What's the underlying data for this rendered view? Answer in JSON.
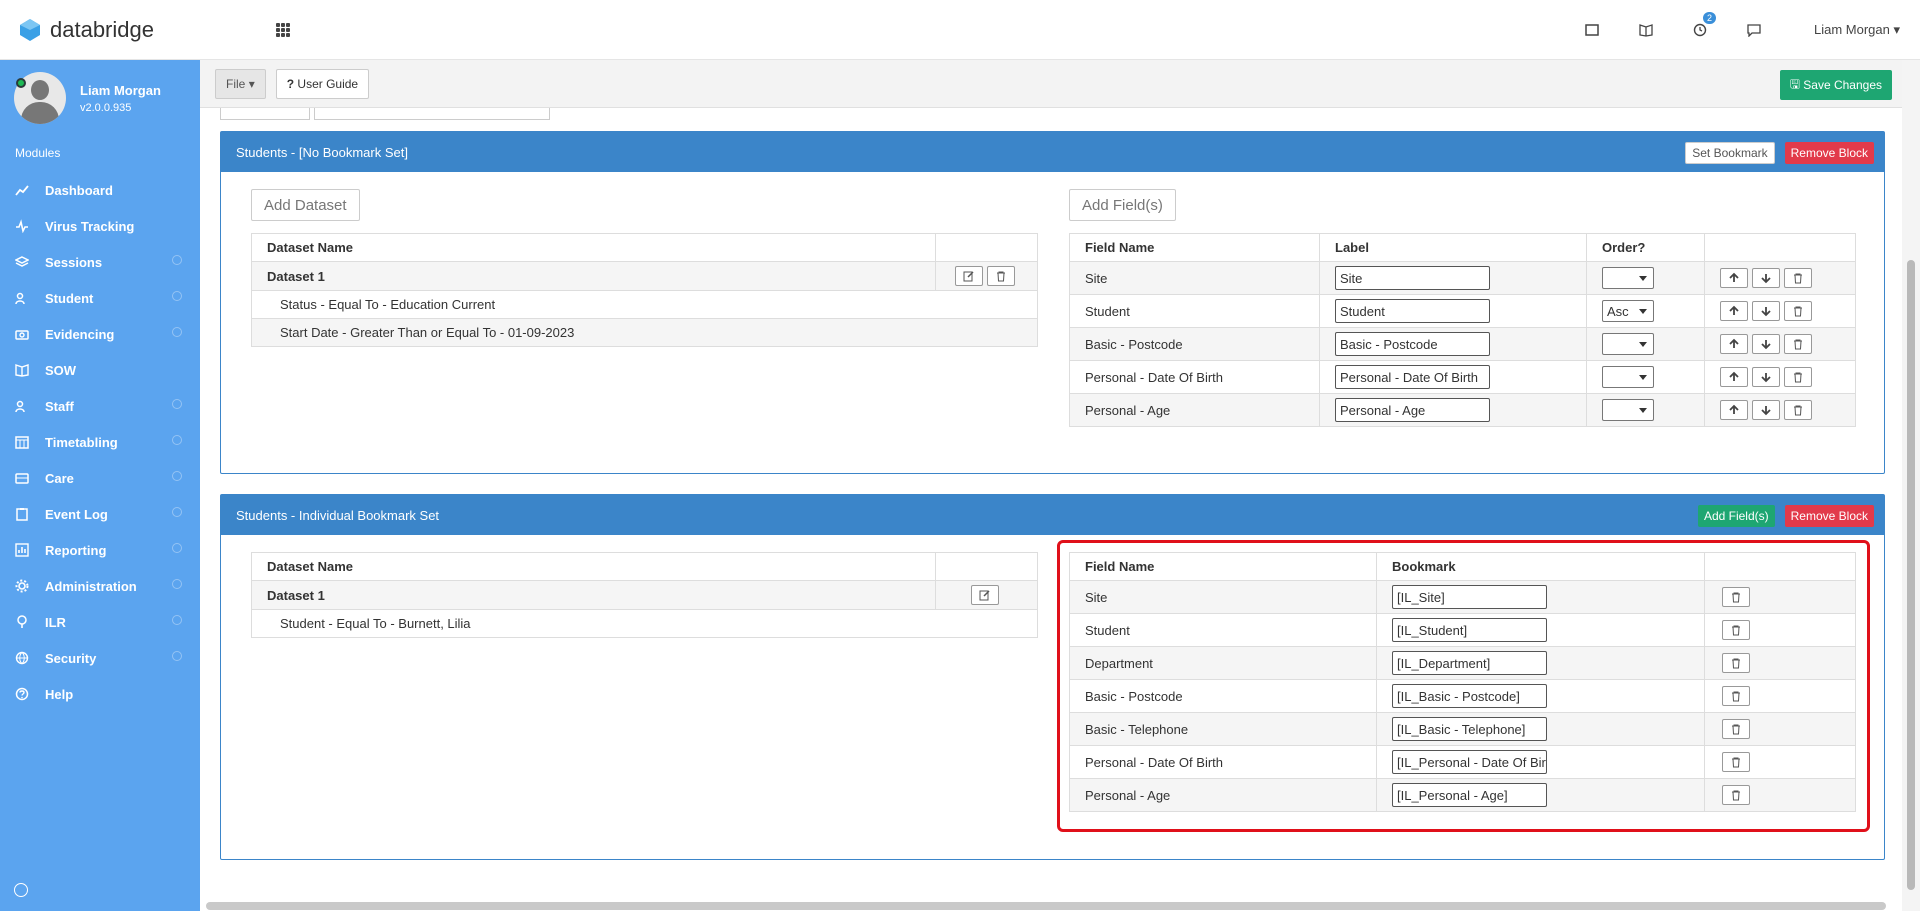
{
  "app": {
    "name": "databridge"
  },
  "topbar": {
    "notif_count": "2",
    "user": "Liam Morgan"
  },
  "sidebar": {
    "user_name": "Liam Morgan",
    "version": "v2.0.0.935",
    "section": "Modules",
    "items": [
      {
        "label": "Dashboard",
        "icon": "chart-line-icon"
      },
      {
        "label": "Virus Tracking",
        "icon": "pulse-icon"
      },
      {
        "label": "Sessions",
        "icon": "layers-icon"
      },
      {
        "label": "Student",
        "icon": "users-icon"
      },
      {
        "label": "Evidencing",
        "icon": "camera-icon"
      },
      {
        "label": "SOW",
        "icon": "book-icon"
      },
      {
        "label": "Staff",
        "icon": "users-icon"
      },
      {
        "label": "Timetabling",
        "icon": "calendar-icon"
      },
      {
        "label": "Care",
        "icon": "id-card-icon"
      },
      {
        "label": "Event Log",
        "icon": "clipboard-icon"
      },
      {
        "label": "Reporting",
        "icon": "bar-chart-icon"
      },
      {
        "label": "Administration",
        "icon": "gear-icon"
      },
      {
        "label": "ILR",
        "icon": "tree-icon"
      },
      {
        "label": "Security",
        "icon": "globe-icon"
      },
      {
        "label": "Help",
        "icon": "question-icon"
      }
    ]
  },
  "toolbar": {
    "file": "File",
    "user_guide": "User Guide",
    "save": "Save Changes"
  },
  "block1": {
    "title": "Students - [No Bookmark Set]",
    "set_bookmark": "Set Bookmark",
    "remove_block": "Remove Block",
    "add_dataset": "Add Dataset",
    "add_fields": "Add Field(s)",
    "dataset_header": "Dataset Name",
    "dataset_name": "Dataset 1",
    "conditions": [
      "Status - Equal To - Education Current",
      "Start Date - Greater Than or Equal To - 01-09-2023"
    ],
    "field_headers": {
      "field": "Field Name",
      "label": "Label",
      "order": "Order?"
    },
    "fields": [
      {
        "field": "Site",
        "label": "Site",
        "order": ""
      },
      {
        "field": "Student",
        "label": "Student",
        "order": "Asc"
      },
      {
        "field": "Basic - Postcode",
        "label": "Basic - Postcode",
        "order": ""
      },
      {
        "field": "Personal - Date Of Birth",
        "label": "Personal - Date Of Birth",
        "order": ""
      },
      {
        "field": "Personal - Age",
        "label": "Personal - Age",
        "order": ""
      }
    ]
  },
  "block2": {
    "title": "Students - Individual Bookmark Set",
    "add_fields": "Add Field(s)",
    "remove_block": "Remove Block",
    "dataset_header": "Dataset Name",
    "dataset_name": "Dataset 1",
    "conditions": [
      "Student - Equal To - Burnett, Lilia"
    ],
    "field_headers": {
      "field": "Field Name",
      "bookmark": "Bookmark"
    },
    "fields": [
      {
        "field": "Site",
        "bookmark": "[IL_Site]"
      },
      {
        "field": "Student",
        "bookmark": "[IL_Student]"
      },
      {
        "field": "Department",
        "bookmark": "[IL_Department]"
      },
      {
        "field": "Basic - Postcode",
        "bookmark": "[IL_Basic - Postcode]"
      },
      {
        "field": "Basic - Telephone",
        "bookmark": "[IL_Basic - Telephone]"
      },
      {
        "field": "Personal - Date Of Birth",
        "bookmark": "[IL_Personal - Date Of Birth]"
      },
      {
        "field": "Personal - Age",
        "bookmark": "[IL_Personal - Age]"
      }
    ]
  },
  "colors": {
    "sidebar": "#5ba4ef",
    "block_header": "#3b85c9",
    "save": "#1ea672",
    "remove": "#e23a4a",
    "highlight": "#e0101a"
  }
}
